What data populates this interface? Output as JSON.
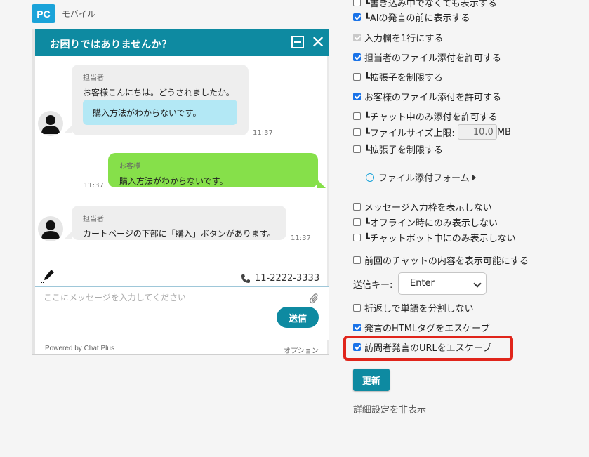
{
  "tabs": {
    "pc": "PC",
    "mobile": "モバイル"
  },
  "widget": {
    "title": "お困りではありませんか？",
    "messages": [
      {
        "sender": "担当者",
        "text": "お客様こんにちは。どうされましたか。",
        "quick_reply": "購入方法がわからないです。",
        "time": "11:37"
      },
      {
        "sender": "お客様",
        "text": "購入方法がわからないです。",
        "time": "11:37"
      },
      {
        "sender": "担当者",
        "text": "カートページの下部に「購入」ボタンがあります。",
        "time": "11:37"
      }
    ],
    "phone": "11-2222-3333",
    "input_placeholder": "ここにメッセージを入力してください",
    "send_label": "送信",
    "powered_by": "Powered by Chat Plus",
    "option_label": "オプション"
  },
  "settings": {
    "partial_top": "┗書き込み中でなくても表示する",
    "items": [
      {
        "label": "┗AIの発言の前に表示する",
        "checked": true
      },
      {
        "label": "入力欄を1行にする",
        "checked": true,
        "disabled": true
      },
      {
        "label": "担当者のファイル添付を許可する",
        "checked": true
      },
      {
        "label": "┗拡張子を制限する",
        "checked": false
      },
      {
        "label": "お客様のファイル添付を許可する",
        "checked": true
      },
      {
        "label": "┗チャット中のみ添付を許可する",
        "checked": false
      },
      {
        "label": "┗ファイルサイズ上限:",
        "checked": false,
        "value": "10.0",
        "unit": "MB"
      },
      {
        "label": "┗拡張子を制限する",
        "checked": false
      },
      {
        "label": "メッセージ入力枠を表示しない",
        "checked": false
      },
      {
        "label": "┗オフライン時にのみ表示しない",
        "checked": false
      },
      {
        "label": "┗チャットボット中にのみ表示しない",
        "checked": false
      },
      {
        "label": "前回のチャットの内容を表示可能にする",
        "checked": false
      },
      {
        "label": "折返しで単語を分割しない",
        "checked": false
      },
      {
        "label": "発言のHTMLタグをエスケープ",
        "checked": true
      },
      {
        "label": "訪問者発言のURLをエスケープ",
        "checked": true
      }
    ],
    "file_form_link": "ファイル添付フォーム",
    "send_key_label": "送信キー:",
    "send_key_value": "Enter",
    "update_label": "更新",
    "hide_details": "詳細設定を非表示"
  },
  "colors": {
    "accent": "#0e8aa1",
    "customer_bubble": "#86e04a",
    "highlight": "#e0251b"
  }
}
